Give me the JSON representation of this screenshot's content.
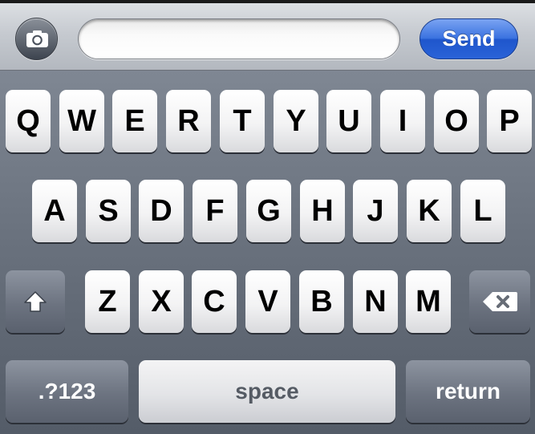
{
  "topbar": {
    "camera_icon": "camera-icon",
    "message_value": "",
    "send_label": "Send"
  },
  "keyboard": {
    "row1": [
      "Q",
      "W",
      "E",
      "R",
      "T",
      "Y",
      "U",
      "I",
      "O",
      "P"
    ],
    "row2": [
      "A",
      "S",
      "D",
      "F",
      "G",
      "H",
      "J",
      "K",
      "L"
    ],
    "row3": [
      "Z",
      "X",
      "C",
      "V",
      "B",
      "N",
      "M"
    ],
    "shift_icon": "shift-arrow-icon",
    "backspace_icon": "backspace-icon",
    "numbers_label": ".?123",
    "space_label": "space",
    "return_label": "return"
  },
  "colors": {
    "send_blue": "#2a63d8",
    "keyboard_bg": "#6a727e",
    "key_light": "#f3f3f4",
    "key_dark": "#6c7380"
  }
}
